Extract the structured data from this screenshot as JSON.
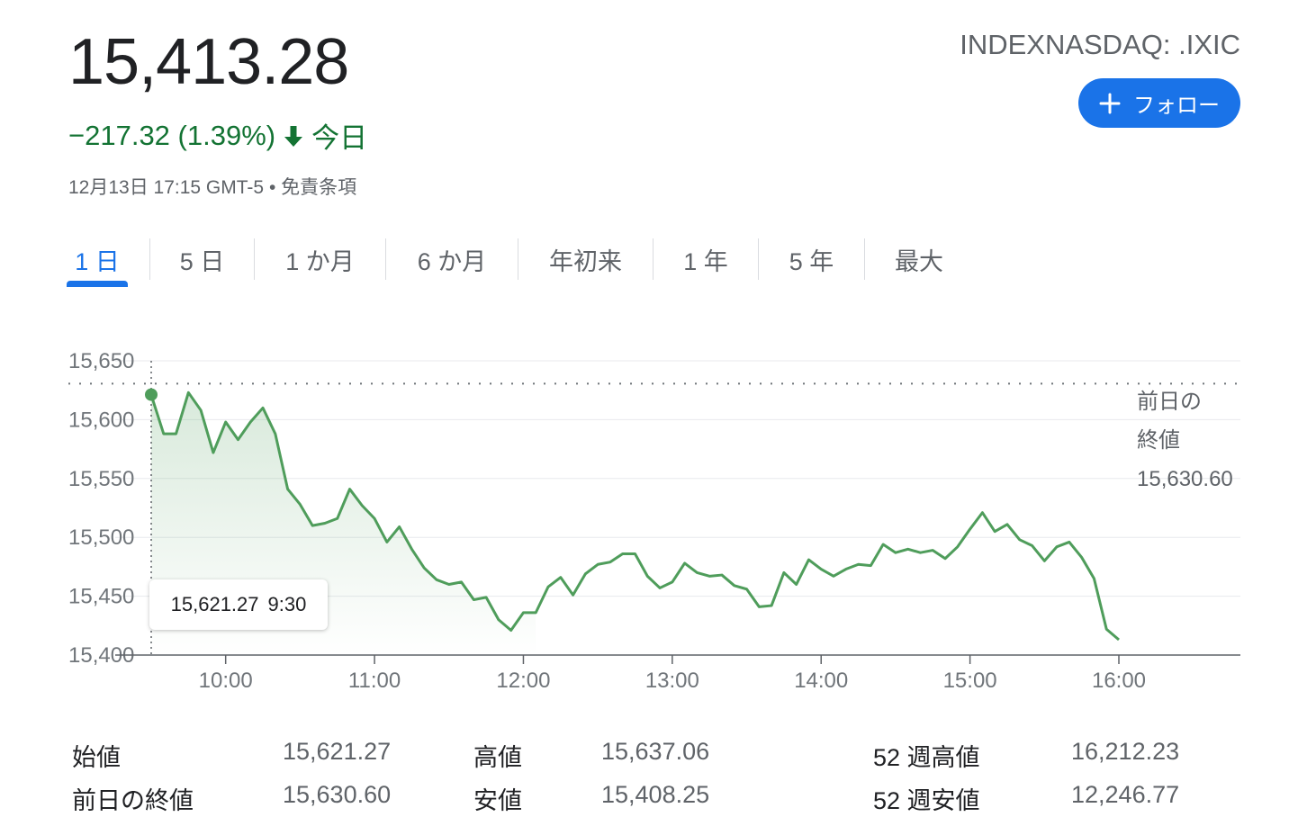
{
  "quote": {
    "price": "15,413.28",
    "change": "−217.32 (1.39%)",
    "change_period": "今日",
    "timestamp": "12月13日 17:15 GMT-5 • 免責条項",
    "ticker": "INDEXNASDAQ: .IXIC",
    "follow_label": "フォロー",
    "change_color": "#137333",
    "accent_color": "#1a73e8"
  },
  "tabs": [
    {
      "label": "1 日",
      "active": true
    },
    {
      "label": "5 日",
      "active": false
    },
    {
      "label": "1 か月",
      "active": false
    },
    {
      "label": "6 か月",
      "active": false
    },
    {
      "label": "年初来",
      "active": false
    },
    {
      "label": "1 年",
      "active": false
    },
    {
      "label": "5 年",
      "active": false
    },
    {
      "label": "最大",
      "active": false
    }
  ],
  "tooltip": {
    "value": "15,621.27",
    "time": "9:30"
  },
  "stats": [
    {
      "label": "始値",
      "value": "15,621.27"
    },
    {
      "label": "前日の終値",
      "value": "15,630.60"
    },
    {
      "label": "高値",
      "value": "15,637.06"
    },
    {
      "label": "安値",
      "value": "15,408.25"
    },
    {
      "label": "52 週高値",
      "value": "16,212.23"
    },
    {
      "label": "52 週安値",
      "value": "12,246.77"
    }
  ],
  "chart_data": {
    "type": "line",
    "line_color": "#4f9d5b",
    "grid": true,
    "ylim": [
      15400,
      15650
    ],
    "xlim": [
      "9:30",
      "16:00"
    ],
    "y_ticks": [
      "15,650",
      "15,600",
      "15,550",
      "15,500",
      "15,450",
      "15,400"
    ],
    "x_ticks": [
      "10:00",
      "11:00",
      "12:00",
      "13:00",
      "14:00",
      "15:00",
      "16:00"
    ],
    "previous_close": {
      "value": 15630.6,
      "label_line1": "前日の",
      "label_line2": "終値",
      "label_value": "15,630.60"
    },
    "hover_point": {
      "time": "9:30",
      "value": 15621.27
    },
    "series": [
      {
        "points": [
          [
            "9:30",
            15621
          ],
          [
            "9:35",
            15588
          ],
          [
            "9:40",
            15588
          ],
          [
            "9:45",
            15623
          ],
          [
            "9:50",
            15608
          ],
          [
            "9:55",
            15572
          ],
          [
            "10:00",
            15598
          ],
          [
            "10:05",
            15583
          ],
          [
            "10:10",
            15598
          ],
          [
            "10:15",
            15610
          ],
          [
            "10:20",
            15588
          ],
          [
            "10:25",
            15541
          ],
          [
            "10:30",
            15528
          ],
          [
            "10:35",
            15510
          ],
          [
            "10:40",
            15512
          ],
          [
            "10:45",
            15516
          ],
          [
            "10:50",
            15541
          ],
          [
            "10:55",
            15527
          ],
          [
            "11:00",
            15516
          ],
          [
            "11:05",
            15496
          ],
          [
            "11:10",
            15509
          ],
          [
            "11:15",
            15490
          ],
          [
            "11:20",
            15474
          ],
          [
            "11:25",
            15464
          ],
          [
            "11:30",
            15460
          ],
          [
            "11:35",
            15462
          ],
          [
            "11:40",
            15447
          ],
          [
            "11:45",
            15449
          ],
          [
            "11:50",
            15430
          ],
          [
            "11:55",
            15421
          ],
          [
            "12:00",
            15436
          ],
          [
            "12:05",
            15436
          ],
          [
            "12:10",
            15458
          ],
          [
            "12:15",
            15466
          ],
          [
            "12:20",
            15451
          ],
          [
            "12:25",
            15469
          ],
          [
            "12:30",
            15477
          ],
          [
            "12:35",
            15479
          ],
          [
            "12:40",
            15486
          ],
          [
            "12:45",
            15486
          ],
          [
            "12:50",
            15467
          ],
          [
            "12:55",
            15457
          ],
          [
            "13:00",
            15462
          ],
          [
            "13:05",
            15478
          ],
          [
            "13:10",
            15470
          ],
          [
            "13:15",
            15467
          ],
          [
            "13:20",
            15468
          ],
          [
            "13:25",
            15459
          ],
          [
            "13:30",
            15456
          ],
          [
            "13:35",
            15441
          ],
          [
            "13:40",
            15442
          ],
          [
            "13:45",
            15470
          ],
          [
            "13:50",
            15460
          ],
          [
            "13:55",
            15481
          ],
          [
            "14:00",
            15473
          ],
          [
            "14:05",
            15467
          ],
          [
            "14:10",
            15473
          ],
          [
            "14:15",
            15477
          ],
          [
            "14:20",
            15476
          ],
          [
            "14:25",
            15494
          ],
          [
            "14:30",
            15487
          ],
          [
            "14:35",
            15490
          ],
          [
            "14:40",
            15487
          ],
          [
            "14:45",
            15489
          ],
          [
            "14:50",
            15482
          ],
          [
            "14:55",
            15492
          ],
          [
            "15:00",
            15507
          ],
          [
            "15:05",
            15521
          ],
          [
            "15:10",
            15505
          ],
          [
            "15:15",
            15511
          ],
          [
            "15:20",
            15498
          ],
          [
            "15:25",
            15493
          ],
          [
            "15:30",
            15480
          ],
          [
            "15:35",
            15492
          ],
          [
            "15:40",
            15496
          ],
          [
            "15:45",
            15483
          ],
          [
            "15:50",
            15465
          ],
          [
            "15:55",
            15422
          ],
          [
            "16:00",
            15413
          ]
        ]
      }
    ]
  }
}
